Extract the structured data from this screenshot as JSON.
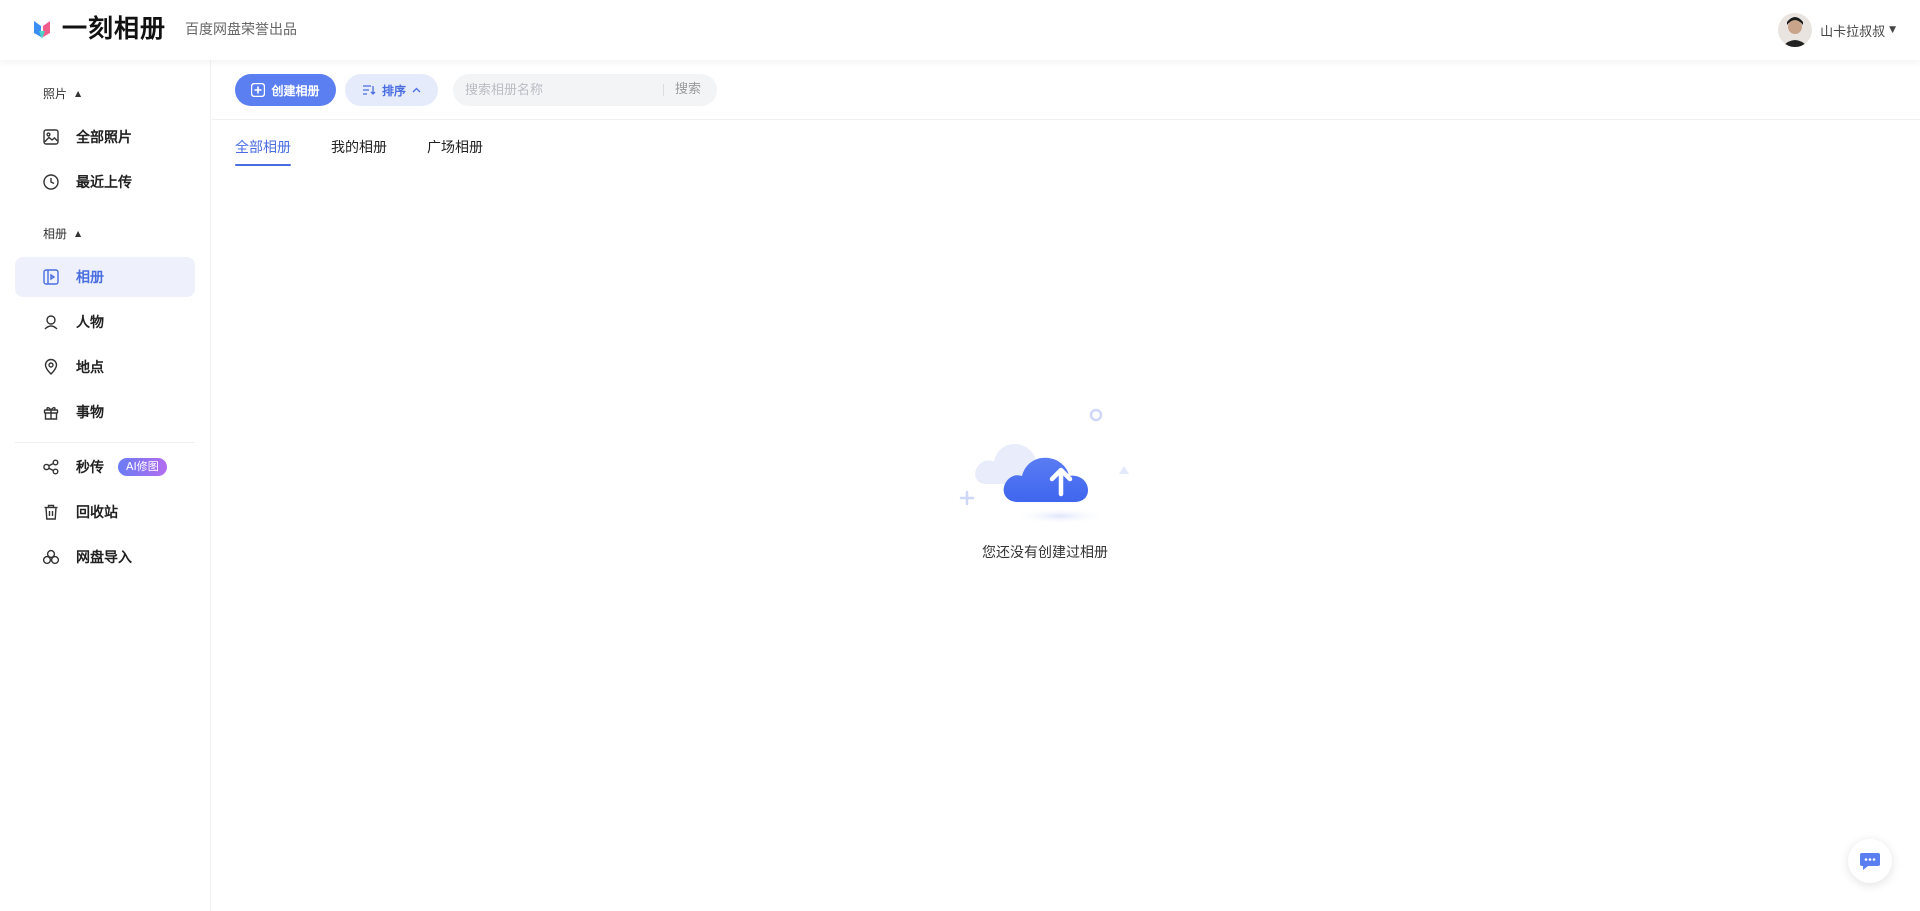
{
  "header": {
    "brand_name": "一刻相册",
    "brand_subtitle": "百度网盘荣誉出品",
    "username": "山卡拉叔叔"
  },
  "sidebar": {
    "photos_section": "照片",
    "albums_section": "相册",
    "items": [
      {
        "label": "全部照片",
        "icon": "image-icon"
      },
      {
        "label": "最近上传",
        "icon": "clock-icon"
      },
      {
        "label": "相册",
        "icon": "album-icon",
        "active": true
      },
      {
        "label": "人物",
        "icon": "person-icon"
      },
      {
        "label": "地点",
        "icon": "location-pin-icon"
      },
      {
        "label": "事物",
        "icon": "gift-icon"
      },
      {
        "label": "秒传",
        "icon": "share-nodes-icon"
      },
      {
        "label": "回收站",
        "icon": "trash-icon"
      },
      {
        "label": "网盘导入",
        "icon": "cloud-import-icon"
      }
    ],
    "ai_badge": "AI修图"
  },
  "toolbar": {
    "create_label": "创建相册",
    "sort_label": "排序",
    "search_placeholder": "搜索相册名称",
    "search_button": "搜索"
  },
  "tabs": [
    {
      "label": "全部相册",
      "active": true
    },
    {
      "label": "我的相册"
    },
    {
      "label": "广场相册"
    }
  ],
  "empty_state": {
    "message": "您还没有创建过相册"
  },
  "colors": {
    "accent": "#4a6ee0",
    "primary_button": "#5b7ff0",
    "active_nav_bg": "#eef1fc"
  }
}
